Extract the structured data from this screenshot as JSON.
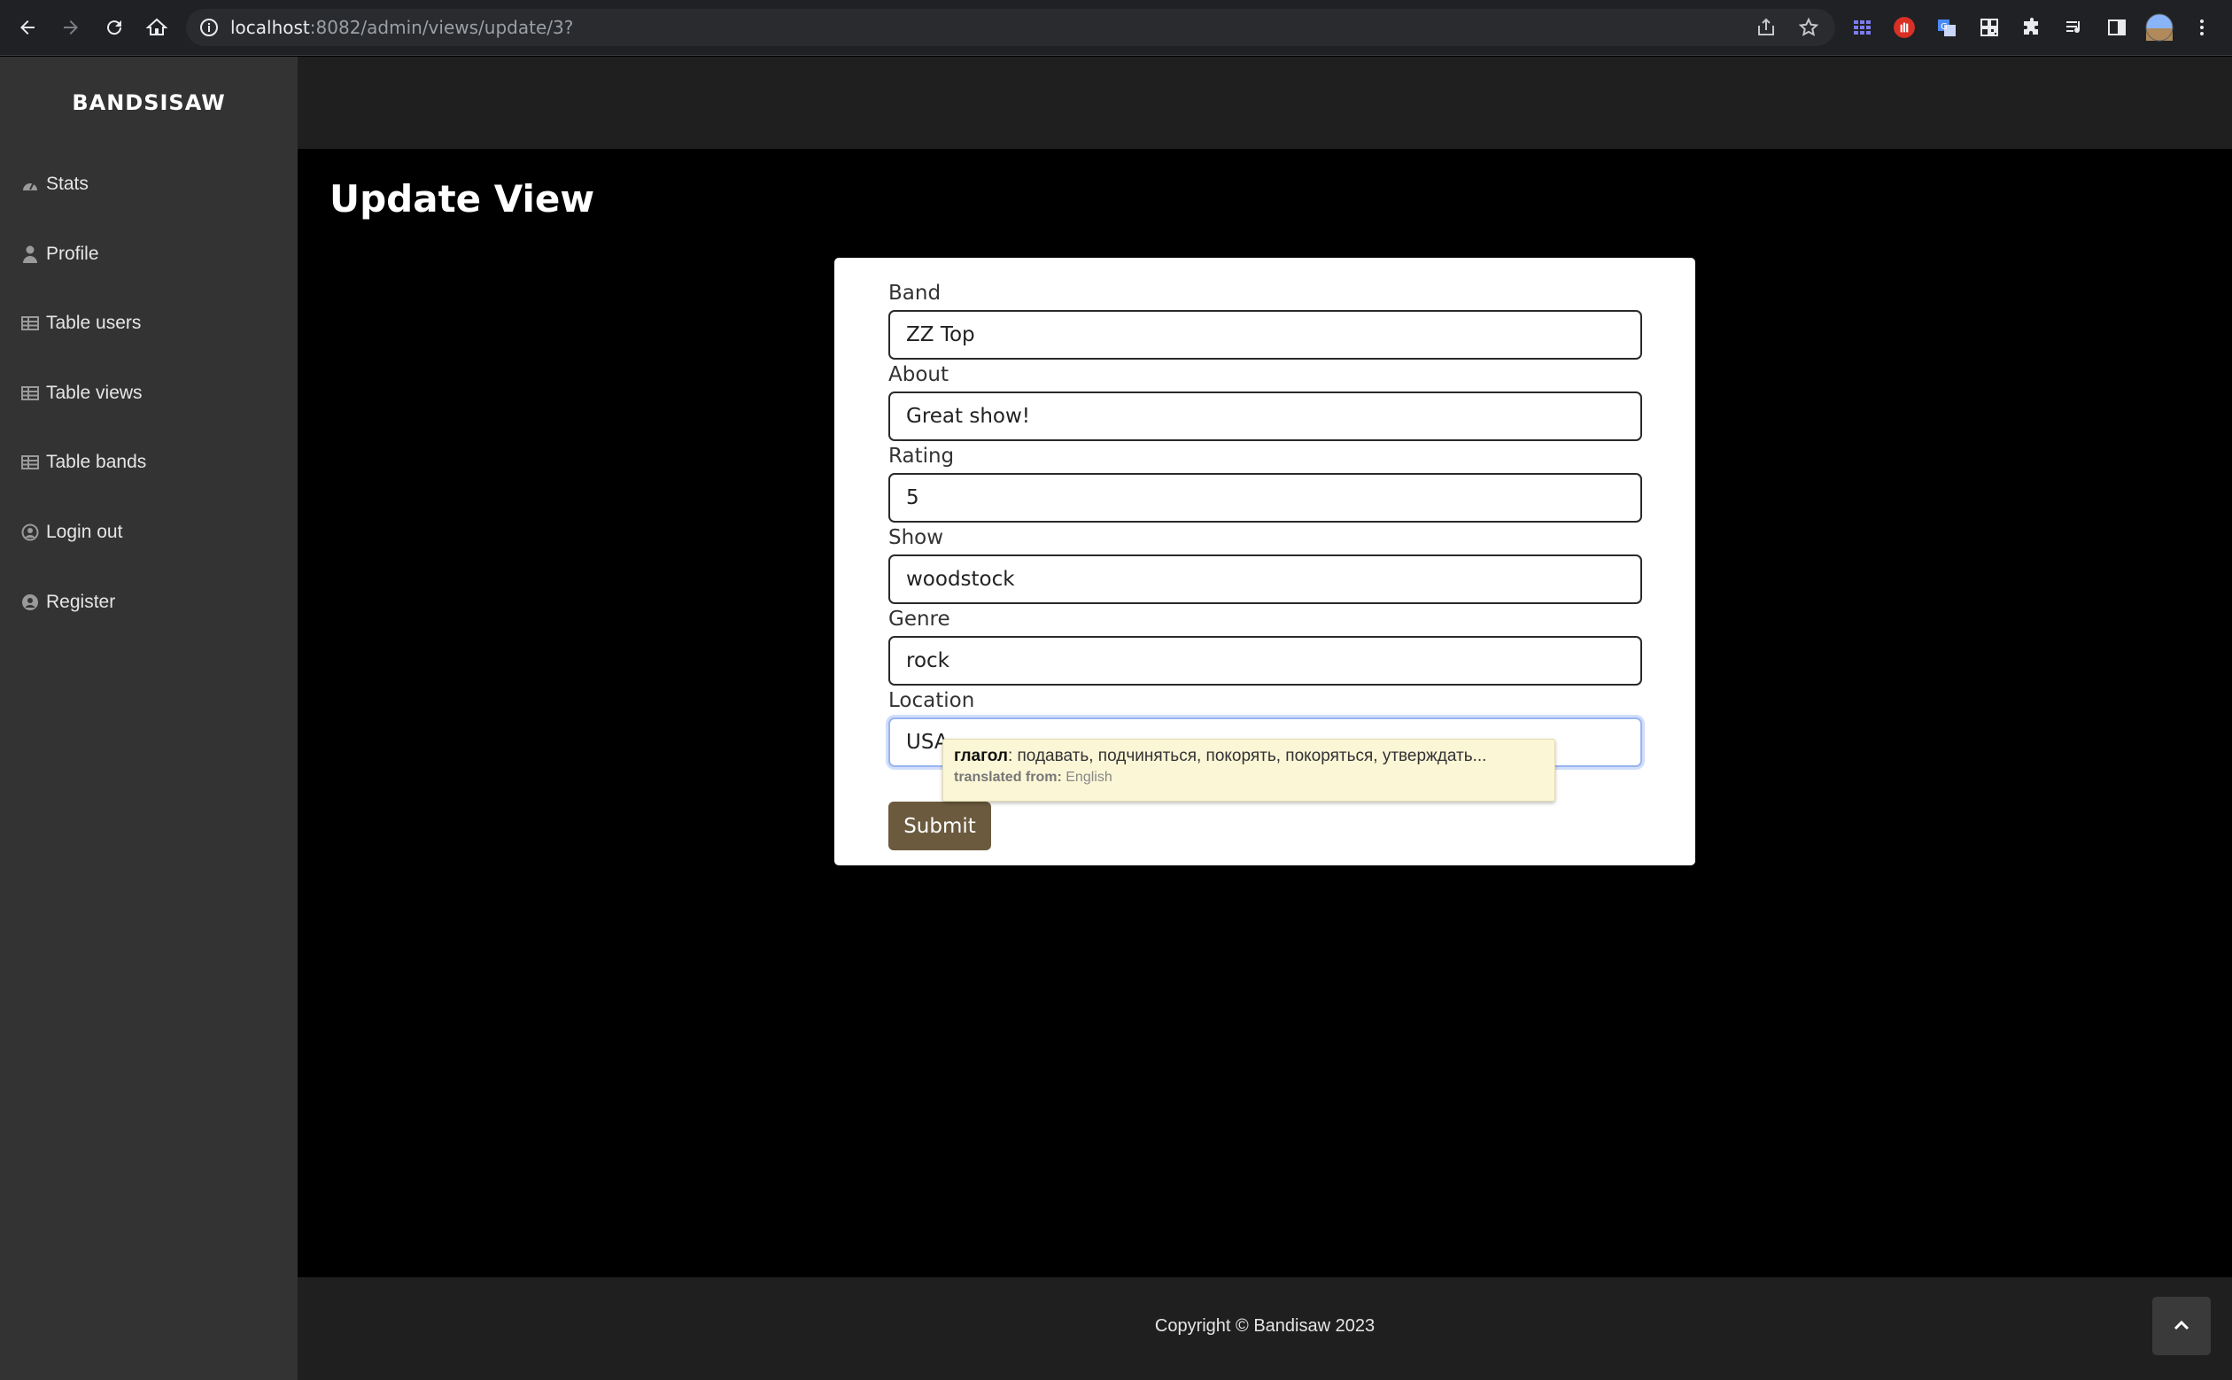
{
  "browser": {
    "url_host": "localhost",
    "url_rest": ":8082/admin/views/update/3?",
    "icons": [
      "back-icon",
      "forward-icon",
      "reload-icon",
      "home-icon",
      "info-icon",
      "share-icon",
      "star-icon",
      "extension-icons",
      "profile-avatar"
    ]
  },
  "sidebar": {
    "brand": "BANDSISAW",
    "items": [
      {
        "label": "Stats",
        "icon": "gauge-icon"
      },
      {
        "label": "Profile",
        "icon": "user-icon"
      },
      {
        "label": "Table users",
        "icon": "table-icon"
      },
      {
        "label": "Table views",
        "icon": "table-icon"
      },
      {
        "label": "Table bands",
        "icon": "table-icon"
      },
      {
        "label": "Login out",
        "icon": "user-circle-icon"
      },
      {
        "label": "Register",
        "icon": "user-circle-icon"
      }
    ]
  },
  "main": {
    "title": "Update View",
    "form": {
      "fields": [
        {
          "label": "Band",
          "value": "ZZ Top"
        },
        {
          "label": "About",
          "value": "Great show!"
        },
        {
          "label": "Rating",
          "value": "5"
        },
        {
          "label": "Show",
          "value": "woodstock"
        },
        {
          "label": "Genre",
          "value": "rock"
        },
        {
          "label": "Location",
          "value": "USA"
        }
      ],
      "submit_label": "Submit"
    }
  },
  "translate_popup": {
    "pos": "глагол",
    "text": ": подавать, подчиняться, покорять, покоряться, утверждать...",
    "from_label": "translated from:",
    "from_lang": "English"
  },
  "footer": {
    "copyright": "Copyright © Bandisaw 2023"
  },
  "colors": {
    "sidebar_bg": "#333333",
    "topbar_bg": "#1f1f1f",
    "content_bg": "#000000",
    "submit_bg": "#6b5a3e",
    "popup_bg": "#fbf6d6"
  }
}
